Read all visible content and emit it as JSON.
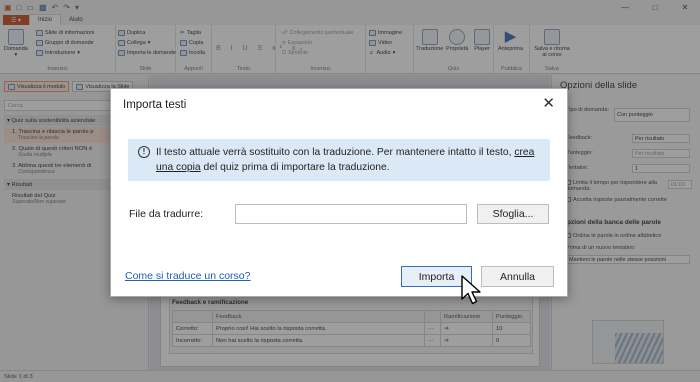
{
  "titlebar": {
    "qa_icons": [
      "app-icon",
      "new-icon",
      "open-icon",
      "save-icon",
      "undo-icon",
      "redo-icon",
      "customize-icon"
    ]
  },
  "tabs": {
    "file_label": "☰ ▾",
    "items": [
      "Inizio",
      "Aiuto"
    ]
  },
  "ribbon": {
    "groups": {
      "inserisci": "Inserisci",
      "slide": "Slide",
      "appunti": "Appunti",
      "testo": "Testo",
      "insert2": "Inserisci",
      "quiz": "Quiz",
      "pubblica": "Pubblica",
      "salva": "Salva"
    },
    "domanda": "Domanda",
    "slide_info": "Slide di informazioni",
    "gruppo_domande": "Gruppo di domande",
    "introduzione": "Introduzione",
    "duplica": "Duplica",
    "collega": "Collega",
    "importa_domande": "Importa le domande",
    "taglia": "Taglia",
    "copia": "Copia",
    "incolla": "Incolla",
    "format_chars": "B I U S x² x₂",
    "collegamento": "Collegamento ipertestuale",
    "equazioni": "Equazioni",
    "simbolo": "Simbolo",
    "immagine": "Immagine",
    "video": "Video",
    "audio": "Audio",
    "traduzione": "Traduzione",
    "proprieta": "Proprietà",
    "player": "Player",
    "anteprima": "Anteprima",
    "salva_ritorna": "Salva e ritorna al corso"
  },
  "leftpanel": {
    "tab1": "Visualizza il modulo",
    "tab2": "Visualizza la Slide",
    "search_placeholder": "Cerca",
    "scene": "Quiz sulla sostenibilità aziendale",
    "slides": [
      {
        "title": "1. Trascina e rilascia le parole p",
        "sub": "Trascina le parole"
      },
      {
        "title": "2. Quale di questi criteri NON è",
        "sub": "Scelta multipla"
      },
      {
        "title": "3. Abbina questi tre elementi di",
        "sub": "Corrispondenza"
      }
    ],
    "results_scene": "Risultati",
    "results_slide": {
      "title": "Risultati del Quiz",
      "sub": "Superato/Non superato"
    }
  },
  "canvas": {
    "fb_title": "Feedback e ramificazione",
    "headers": [
      "",
      "Feedback",
      "",
      "Ramificazione",
      "Punteggio"
    ],
    "rows": [
      {
        "label": "Corretto:",
        "text": "Proprio così! Hai scelto la risposta corretta.",
        "more": "···",
        "arrow": "➔",
        "score": "10"
      },
      {
        "label": "Incorretto:",
        "text": "Non hai scelto la risposta corretta.",
        "more": "···",
        "arrow": "➔",
        "score": "0"
      }
    ]
  },
  "rightpanel": {
    "title": "Opzioni della slide",
    "tipo_label": "Tipo di domanda:",
    "tipo_value": "Con punteggio",
    "feedback_label": "Feedback:",
    "feedback_value": "Per risultato",
    "punteggio_label": "Punteggio:",
    "punteggio_value": "Per risultato",
    "tentativi_label": "Tentativi:",
    "tentativi_value": "1",
    "limita_label": "Limita il tempo per rispondere alla domanda:",
    "limita_value": "01:00",
    "accetta_label": "Accetta risposte parzialmente corrette",
    "banca_title": "Opzioni della banca delle parole",
    "ordina_label": "Ordina le parole in ordine alfabetico",
    "nuovo_tentativo_label": "Prima di un nuovo tentativo:",
    "nuovo_tentativo_value": "Mantieni le parole nelle stesse posizioni"
  },
  "statusbar": {
    "text": "Slide 1 di 3"
  },
  "dialog": {
    "title": "Importa testi",
    "close": "✕",
    "info_prefix": "Il testo attuale verrà sostituito con la traduzione. Per mantenere intatto il testo,",
    "info_link": "crea una copia",
    "info_suffix": " del quiz prima di importare la traduzione.",
    "file_label": "File da tradurre:",
    "file_value": "",
    "browse": "Sfoglia...",
    "help_link": "Come si traduce un corso?",
    "import_button": "Importa",
    "cancel_button": "Annulla"
  }
}
